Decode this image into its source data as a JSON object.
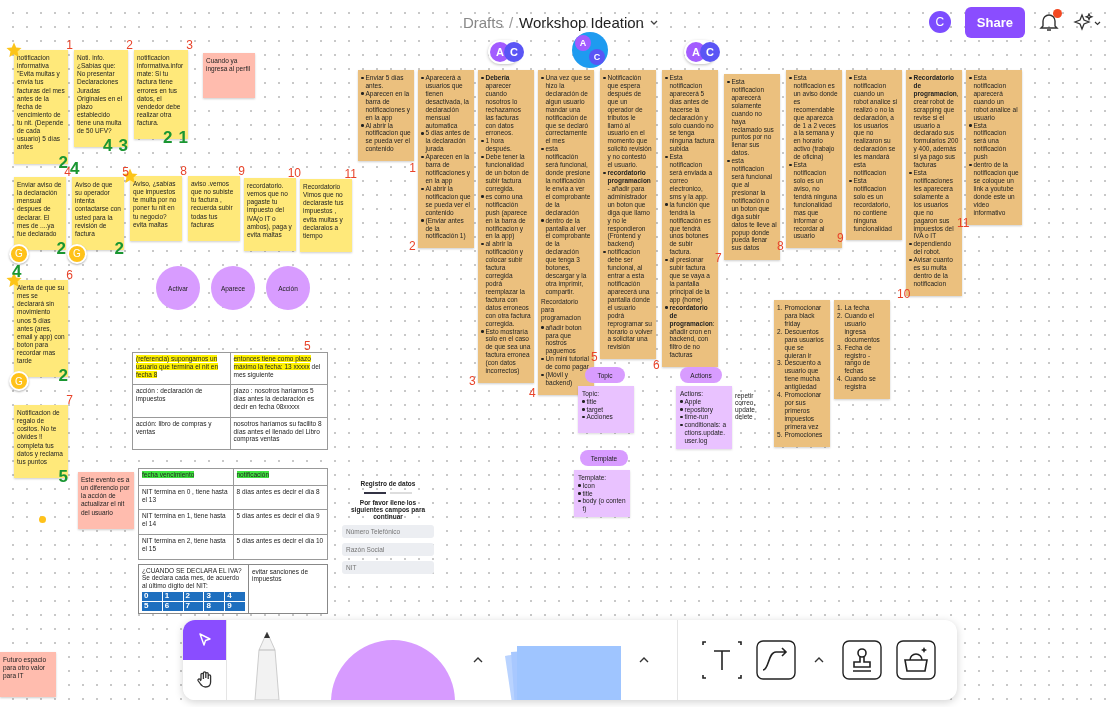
{
  "header": {
    "breadcrumb": "Drafts",
    "separator": "/",
    "title": "Workshop Ideation",
    "user_initial": "C",
    "share": "Share",
    "notifications_unread": true
  },
  "cursors": [
    {
      "avatars": [
        {
          "initial": "A",
          "color": "#a35cff"
        },
        {
          "initial": "C",
          "color": "#5a55f5"
        }
      ]
    },
    {
      "avatars": [
        {
          "initial": "A",
          "color": "#a35cff"
        },
        {
          "initial": "C",
          "color": "#5a55f5"
        }
      ]
    },
    {
      "avatars": [
        {
          "initial": "A",
          "color": "#a35cff"
        },
        {
          "initial": "C",
          "color": "#5a55f5"
        }
      ]
    }
  ],
  "notes": [
    {
      "kind": "yellow",
      "text": "notificacion informativa \"Evita multas y envía tus facturas del mes antes de la fecha de vencimiento de tu nit. (Depende de cada usuario) 5 días antes",
      "number": "1",
      "star": true,
      "votes": [
        "2"
      ]
    },
    {
      "kind": "yellow",
      "text": "Noti. info. ¿Sabías que: No presentar Declaraciones Juradas Originales en el plazo establecido tiene una multa de 50 UFV?",
      "number": "2",
      "star": false,
      "votes": [
        "4",
        "3"
      ]
    },
    {
      "kind": "yellow",
      "text": "notificacion informativa.infor mate: Si tu factura tiene errores en tus datos, el vendedor debe realizar otra factura.",
      "number": "3",
      "star": false,
      "votes": [
        "2",
        "1"
      ]
    },
    {
      "kind": "pink",
      "text": "Cuando ya ingresa al perfil",
      "star": false
    },
    {
      "kind": "yellow",
      "text": "Enviar aviso de la declaración mensual despues de declarar. El mes de ....ya fue declarado",
      "number": "4",
      "star": false,
      "avatar": "G",
      "votes": [
        "2"
      ]
    },
    {
      "kind": "yellow",
      "text": "Aviso de que su operador intenta contactarse con usted para la revisión de factura",
      "number": "5",
      "star": false,
      "avatar": "G",
      "top_vote": "4",
      "votes": [
        "2"
      ]
    },
    {
      "kind": "yellow",
      "text": "Aviso, ¿sabías que impuestos te multa por no poner tu nit en tu negocio? evita maltas",
      "number": "8",
      "star": true
    },
    {
      "kind": "yellow",
      "text": "aviso .vemos que no subiste tu factura , recuerda subir todas tus facturas",
      "number": "9",
      "star": false
    },
    {
      "kind": "yellow",
      "text": "recordatorio. vemos que no pagaste tu impuesto del IVA(o IT o ambos), paga y evita maltas",
      "number": "10",
      "star": false
    },
    {
      "kind": "yellow",
      "text": "Recordatorio Vimos que no declaraste tus impuestos , evita multas y declaralos a tiempo",
      "number": "11",
      "star": false
    },
    {
      "kind": "yellow",
      "text": "Alerta de que su mes se declarará sin movimiento unos 5 días antes (ares, email y app) con boton para recordar mas tarde",
      "number": "6",
      "star": true,
      "avatar": "G",
      "top_vote": "4",
      "votes": [
        "2"
      ]
    },
    {
      "kind": "yellow",
      "text": "Notificacion de regalo de cositos. No te olvides !! completa tus datos y reclama tus puntos",
      "number": "7",
      "star": false,
      "votes": [
        "5"
      ]
    },
    {
      "kind": "pink",
      "text": "Este evento es a un diferencio por la acción de actualizar el nit del usuario",
      "star": false
    },
    {
      "kind": "pink",
      "text": "Futuro espacio para otro valor para IT",
      "star": false
    }
  ],
  "spec_notes": [
    {
      "number": "1",
      "blocks": [
        {
          "kind": "bullet",
          "text": "Enviar 5 días antes."
        },
        {
          "kind": "bullet",
          "text": "Aparecen en la barra de notificaciones y en la app"
        },
        {
          "kind": "bullet",
          "text": "Al abrir la notificacion que se pueda ver el contenido"
        }
      ]
    },
    {
      "number": "2",
      "blocks": [
        {
          "kind": "bullet",
          "text": "Aparecerá a usuarios que tienen desactivada, la declaración mensual automatica"
        },
        {
          "kind": "bullet",
          "text": "5 días antes de la declaración jurada"
        },
        {
          "kind": "bullet",
          "text": "Aparecen en la barra de notificaciones y en la app"
        },
        {
          "kind": "bullet",
          "text": "Al abrir la notificacion que se pueda ver el contenido"
        },
        {
          "kind": "bullet",
          "text": "(Enviar antes de la notificación 1)"
        }
      ]
    },
    {
      "number": "3",
      "blocks": [
        {
          "kind": "bullet",
          "text": "**Debería** aparecer cuando nosotros lo rechazamos las facturas con datos erroneos."
        },
        {
          "kind": "bullet",
          "text": "1 hora después."
        },
        {
          "kind": "bullet",
          "text": "Debe tener la funcionalidad de un boton de subir factura corregida."
        },
        {
          "kind": "bullet",
          "text": "es como una notificación push (aparece en la barra de notificacion y en la app)"
        },
        {
          "kind": "bullet",
          "text": "al abrir la notificación y colocar subir factura corregida podrá reemplazar la factura con datos erroneos con otra factura corregida."
        },
        {
          "kind": "bullet",
          "text": "Esto mostraría solo en el caso de que sea una factura erronea (con datos incorrectos)"
        }
      ]
    },
    {
      "number": "4",
      "blocks": [
        {
          "kind": "bullet",
          "text": "Una vez que se hizo la declaración de algun usuario mandar una notificación de que se declaró correctamente el mes"
        },
        {
          "kind": "bullet",
          "text": "esta notificación será funcional, donde presione la notificación le envía a ver el comprobante de la declaración"
        },
        {
          "kind": "bullet",
          "text": "dentro de la pantalla al ver el comprobante de la declaración que tenga 3 botones, descargar y la otra imprimir, compartir."
        },
        {
          "kind": "paragraph",
          "text": "Recordatorio para programacion"
        },
        {
          "kind": "bullet",
          "text": "añadir boton para que nostros paguemos"
        },
        {
          "kind": "bullet",
          "text": "Un mini tutorial de como pagar"
        },
        {
          "kind": "bullet",
          "text": "(Móvil y backend)"
        }
      ]
    },
    {
      "number": "5",
      "blocks": [
        {
          "kind": "bullet",
          "text": "Notificación que espera después de que un operador de tributos le llamó al usuario en el momento que solicitó revisión y no contestó el usuario."
        },
        {
          "kind": "bullet",
          "text": "**recordatorio programacion** - añadir para administrador un boton que diga que llamo y no le respondieron (Frontend y backend)"
        },
        {
          "kind": "bullet",
          "text": "notificacion debe ser funcional, al entrar a esta notificación aparecerá una pantalla donde el usuario podrá reprogramar su horario o volver a solicitar una revisión"
        }
      ]
    },
    {
      "number": "6",
      "blocks": [
        {
          "kind": "bullet",
          "text": "Esta notificacion aparecerá 5 días antes de hacerse la declaración y solo cuando no se tenga ninguna factura subida"
        },
        {
          "kind": "bullet",
          "text": "Esta notificacion será enviada a correo electronico, sms y la app."
        },
        {
          "kind": "bullet",
          "text": "la función que tendrá la notificación es que tendrá unos botones de subir factura."
        },
        {
          "kind": "bullet",
          "text": "al presionar subir factura que se vaya a la pantalla principal de la app (home)"
        },
        {
          "kind": "bullet",
          "text": "**recordatorio de programacion**: añadir cron en backend, con filtro de no facturas"
        }
      ]
    },
    {
      "number": "7",
      "blocks": [
        {
          "kind": "bullet",
          "text": "Esta notificacion aparecerá solamente cuando no haya reclamado sus puntos por no llenar sus datos."
        },
        {
          "kind": "bullet",
          "text": "esta notificacion será funcional que al presionar la notificación o un boton que diga subir datos te lleve al popup donde pueda llenar sus datos"
        }
      ]
    },
    {
      "number": "8",
      "blocks": [
        {
          "kind": "bullet",
          "text": "Esta notificacion es un aviso donde es recomendable que aparezca de 1 a 2 veces a la semana y en horario activo (trabajo de oficina)"
        },
        {
          "kind": "bullet",
          "text": "Esta notificacion solo es un aviso, no tendrá ninguna funcionalidad mas que informar o recordar al usuario"
        }
      ]
    },
    {
      "number": "9",
      "blocks": [
        {
          "kind": "bullet",
          "text": "Esta notificacion cuando un robot analice si realizó o no la declaración, a los usuarios que no realizaron su declaración se les mandará esta notificacion"
        },
        {
          "kind": "bullet",
          "text": "Esta notificacion solo es un recordatorio, no contiene ninguna funcionalidad"
        }
      ]
    },
    {
      "number": "10",
      "blocks": [
        {
          "kind": "bullet",
          "text": "**Recordatorio de programacion**, crear robot de scrapping que revise si el usuario a declarado sus formularios 200 y 400, además si ya pago sus facturas"
        },
        {
          "kind": "bullet",
          "text": "Esta notificaciones les aparecera solamente a los usuarios que no pagaron sus impuestos del IVA o IT"
        },
        {
          "kind": "bullet",
          "text": "dependiendo del robot."
        },
        {
          "kind": "bullet",
          "text": "Avisar cuanto es su multa dentro de la notificacion"
        }
      ]
    },
    {
      "number": "11",
      "blocks": [
        {
          "kind": "bullet",
          "text": "Esta notificacion aparecerá cuando un robot analice al usuario"
        },
        {
          "kind": "bullet",
          "text": "Esta notificacion será una notificación push"
        },
        {
          "kind": "bullet",
          "text": "dentro de la notificacion que se coloque un link a youtube donde este un video informativo"
        }
      ]
    },
    {
      "blocks": [
        {
          "kind": "numbered",
          "marker": "1.",
          "text": "Promocionar para black friday"
        },
        {
          "kind": "numbered",
          "marker": "2.",
          "text": "Descuentos para usuarios que se quieran ir"
        },
        {
          "kind": "numbered",
          "marker": "3.",
          "text": "Descuento a usuario que tiene mucha antigüedad"
        },
        {
          "kind": "numbered",
          "marker": "4.",
          "text": "Promocionar por sus primeros impuestos primera vez"
        },
        {
          "kind": "numbered",
          "marker": "5.",
          "text": "Promociones"
        }
      ]
    },
    {
      "blocks": [
        {
          "kind": "numbered",
          "marker": "1.",
          "text": "La fecha"
        },
        {
          "kind": "numbered",
          "marker": "2.",
          "text": "Cuando el usuario ingresa documentos"
        },
        {
          "kind": "numbered",
          "marker": "3.",
          "text": "Fecha de registro - rango de fechas"
        },
        {
          "kind": "numbered",
          "marker": "4.",
          "text": "Cuando se registra"
        }
      ]
    }
  ],
  "circles": [
    "Activar",
    "Aparece",
    "Acción"
  ],
  "tables": [
    {
      "number": "5",
      "rows": [
        [
          [
            {
              "text": "(referencia) supongamos un usuario que termina el nit en fecha 8",
              "highlight": true
            }
          ],
          [
            {
              "text": "entonces tiene como plazo máximo la fecha: 13 xxxxx",
              "highlight": true
            },
            {
              "text": " del mes siguiente",
              "highlight": false
            }
          ]
        ],
        [
          [
            {
              "text": "acción : declaración de impuestos",
              "highlight": false
            }
          ],
          [
            {
              "text": "plazo : nosotros haríamos 5 días antes la declaración es decir en fecha 08xxxxx",
              "highlight": false
            }
          ]
        ],
        [
          [
            {
              "text": "acción: libro de compras y ventas",
              "highlight": false
            }
          ],
          [
            {
              "text": "nosotros haríamos su facilito 8 días antes el llenado del Libro compras ventas",
              "highlight": false
            }
          ]
        ]
      ]
    },
    {
      "rows": [
        [
          [
            {
              "text": "fecha vencimiento",
              "highlight": true
            }
          ],
          [
            {
              "text": "notificación",
              "highlight": true
            }
          ]
        ],
        [
          [
            {
              "text": "NIT termina en 0 , tiene hasta el 13",
              "highlight": false
            }
          ],
          [
            {
              "text": "8 días antes es decir el día 8",
              "highlight": false
            }
          ]
        ],
        [
          [
            {
              "text": "NIT termina en 1, tiene hasta el 14",
              "highlight": false
            }
          ],
          [
            {
              "text": "5 días antes es decir el día 9",
              "highlight": false
            }
          ]
        ],
        [
          [
            {
              "text": "NIT termina en 2, tiene hasta el 15",
              "highlight": false
            }
          ],
          [
            {
              "text": "5 días antes es decir el día 10",
              "highlight": false
            }
          ]
        ]
      ]
    }
  ],
  "iva_card": {
    "heading": "¿CUANDO SE DECLARA EL IVA?",
    "text": "Se declara cada mes, de acuerdo al último dígito del NIT:",
    "digits": [
      "0",
      "1",
      "2",
      "3",
      "4",
      "5",
      "6",
      "7",
      "8",
      "9"
    ],
    "note": "evitar sanciones de impuestos"
  },
  "phone_form": {
    "title": "Registro de datos",
    "subtitle": "Por favor llene los siguientes campos para continuar",
    "fields": [
      {
        "placeholder": "Número Telefónico"
      },
      {
        "placeholder": "Razón Social"
      },
      {
        "placeholder": "NIT"
      }
    ]
  },
  "cards": [
    {
      "pill": "Topic",
      "heading": "Topic:",
      "items": [
        "title",
        "target",
        "Acciones"
      ]
    },
    {
      "pill": "Actions",
      "heading": "Actions:",
      "items": [
        "Apple",
        "repository",
        "time-run",
        "conditionals: actions.update.user.log"
      ]
    },
    {
      "pill": "Template",
      "heading": "Template:",
      "items": [
        "Icon",
        "title",
        "body (o content)"
      ]
    }
  ],
  "side_note": "repetir correo, update, delete",
  "toolbar": [
    {
      "kind": "select",
      "selected": true
    },
    {
      "kind": "hand",
      "selected": false
    },
    {
      "kind": "pen",
      "selected": false
    },
    {
      "kind": "shape",
      "selected": false
    },
    {
      "kind": "sticky",
      "selected": false
    },
    {
      "kind": "text",
      "selected": false
    },
    {
      "kind": "connector",
      "selected": false
    },
    {
      "kind": "stamp",
      "selected": false
    },
    {
      "kind": "widget",
      "selected": false
    }
  ]
}
